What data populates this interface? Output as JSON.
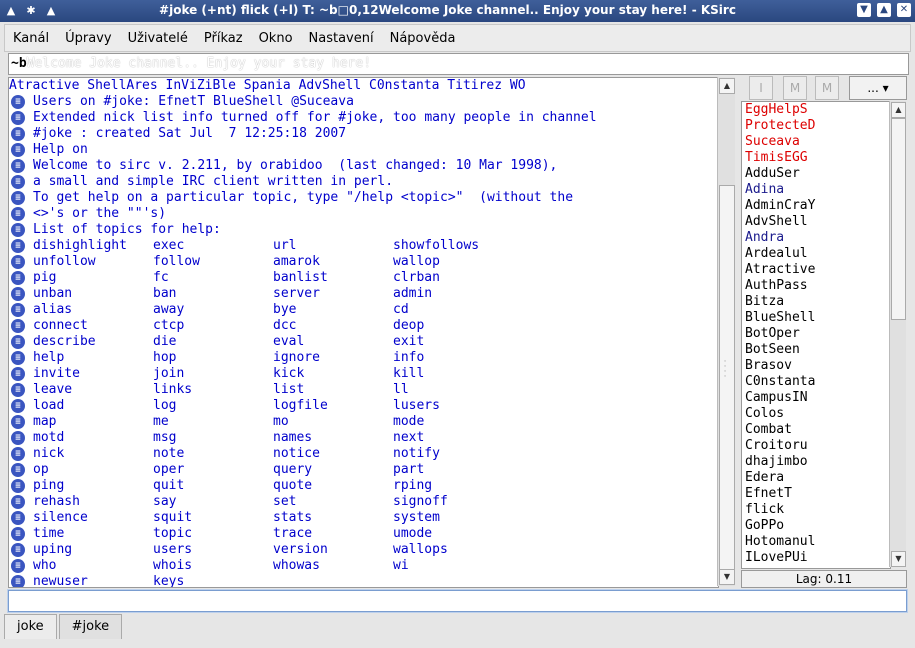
{
  "window": {
    "title": "#joke (+nt) flick (+l) T: ~b□0,12Welcome Joke channel.. Enjoy your stay here! - KSirc"
  },
  "menu": [
    "Kanál",
    "Úpravy",
    "Uživatelé",
    "Příkaz",
    "Okno",
    "Nastavení",
    "Nápověda"
  ],
  "topic": {
    "ctrl": "~b",
    "text": "Welcome Joke channel.. Enjoy your stay here!"
  },
  "messages": [
    {
      "icon": false,
      "text": "Atractive ShellAres InViZiBle Spania AdvShell C0nstanta Titirez WO"
    },
    {
      "icon": true,
      "text": "Users on #joke: EfnetT BlueShell @Suceava"
    },
    {
      "icon": true,
      "text": "Extended nick list info turned off for #joke, too many people in channel"
    },
    {
      "icon": true,
      "text": "#joke : created Sat Jul  7 12:25:18 2007"
    },
    {
      "icon": true,
      "text": "Help on"
    },
    {
      "icon": true,
      "text": "Welcome to sirc v. 2.211, by orabidoo  (last changed: 10 Mar 1998),"
    },
    {
      "icon": true,
      "text": "a small and simple IRC client written in perl."
    },
    {
      "icon": true,
      "text": "To get help on a particular topic, type \"/help <topic>\"  (without the"
    },
    {
      "icon": true,
      "text": "<>'s or the \"\"'s)"
    },
    {
      "icon": true,
      "text": "List of topics for help:"
    }
  ],
  "help_rows": [
    [
      "dishighlight",
      "exec",
      "url",
      "showfollows"
    ],
    [
      "unfollow",
      "follow",
      "amarok",
      "wallop"
    ],
    [
      "pig",
      "fc",
      "banlist",
      "clrban"
    ],
    [
      "unban",
      "ban",
      "server",
      "admin"
    ],
    [
      "alias",
      "away",
      "bye",
      "cd"
    ],
    [
      "connect",
      "ctcp",
      "dcc",
      "deop"
    ],
    [
      "describe",
      "die",
      "eval",
      "exit"
    ],
    [
      "help",
      "hop",
      "ignore",
      "info"
    ],
    [
      "invite",
      "join",
      "kick",
      "kill"
    ],
    [
      "leave",
      "links",
      "list",
      "ll"
    ],
    [
      "load",
      "log",
      "logfile",
      "lusers"
    ],
    [
      "map",
      "me",
      "mo",
      "mode"
    ],
    [
      "motd",
      "msg",
      "names",
      "next"
    ],
    [
      "nick",
      "note",
      "notice",
      "notify"
    ],
    [
      "op",
      "oper",
      "query",
      "part"
    ],
    [
      "ping",
      "quit",
      "quote",
      "rping"
    ],
    [
      "rehash",
      "say",
      "set",
      "signoff"
    ],
    [
      "silence",
      "squit",
      "stats",
      "system"
    ],
    [
      "time",
      "topic",
      "trace",
      "umode"
    ],
    [
      "uping",
      "users",
      "version",
      "wallops"
    ],
    [
      "who",
      "whois",
      "whowas",
      "wi"
    ],
    [
      "newuser",
      "keys",
      "",
      ""
    ]
  ],
  "nick_toolbar": {
    "buttons": [
      "I",
      "M",
      "M"
    ],
    "more_label": "... ▾"
  },
  "nicks": [
    {
      "name": "EggHelpS",
      "color": "#dd0000"
    },
    {
      "name": "ProtecteD",
      "color": "#dd0000"
    },
    {
      "name": "Suceava",
      "color": "#dd0000"
    },
    {
      "name": "TimisEGG",
      "color": "#dd0000"
    },
    {
      "name": "AdduSer",
      "color": "#000000"
    },
    {
      "name": "Adina",
      "color": "#1a1a8c"
    },
    {
      "name": "AdminCraY",
      "color": "#000000"
    },
    {
      "name": "AdvShell",
      "color": "#000000"
    },
    {
      "name": "Andra",
      "color": "#1a1a8c"
    },
    {
      "name": "Ardealul",
      "color": "#000000"
    },
    {
      "name": "Atractive",
      "color": "#000000"
    },
    {
      "name": "AuthPass",
      "color": "#000000"
    },
    {
      "name": "Bitza",
      "color": "#000000"
    },
    {
      "name": "BlueShell",
      "color": "#000000"
    },
    {
      "name": "BotOper",
      "color": "#000000"
    },
    {
      "name": "BotSeen",
      "color": "#000000"
    },
    {
      "name": "Brasov",
      "color": "#000000"
    },
    {
      "name": "C0nstanta",
      "color": "#000000"
    },
    {
      "name": "CampusIN",
      "color": "#000000"
    },
    {
      "name": "Colos",
      "color": "#000000"
    },
    {
      "name": "Combat",
      "color": "#000000"
    },
    {
      "name": "Croitoru",
      "color": "#000000"
    },
    {
      "name": "dhajimbo",
      "color": "#000000"
    },
    {
      "name": "Edera",
      "color": "#000000"
    },
    {
      "name": "EfnetT",
      "color": "#000000"
    },
    {
      "name": "flick",
      "color": "#000000"
    },
    {
      "name": "GoPPo",
      "color": "#000000"
    },
    {
      "name": "Hotomanul",
      "color": "#000000"
    },
    {
      "name": "ILovePUi",
      "color": "#000000"
    }
  ],
  "lag": "Lag: 0.11",
  "tabs": [
    "joke",
    "#joke"
  ],
  "input": {
    "value": ""
  }
}
